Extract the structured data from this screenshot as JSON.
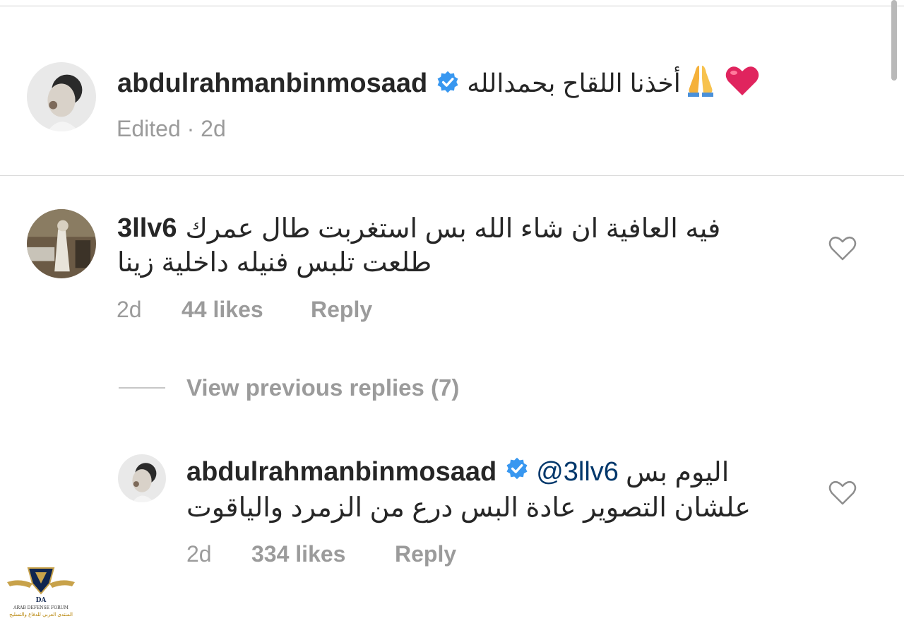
{
  "post": {
    "username": "abdulrahmanbinmosaad",
    "caption": "أخذنا اللقاح بحمدالله",
    "meta": "Edited · 2d"
  },
  "comment": {
    "username": "3llv6",
    "line1": "فيه العافية ان شاء الله بس استغربت طال عمرك",
    "line2": "طلعت تلبس فنيله داخلية زينا",
    "time": "2d",
    "likes": "44 likes",
    "reply": "Reply"
  },
  "replies": {
    "view_previous": "View previous replies (7)"
  },
  "reply": {
    "username": "abdulrahmanbinmosaad",
    "mention": "@3llv6",
    "line1_text": "اليوم بس",
    "line2": "علشان التصوير عادة البس درع من الزمرد والياقوت",
    "time": "2d",
    "likes": "334 likes",
    "reply": "Reply"
  },
  "watermark": {
    "mark": "DA",
    "title": "ARAB DEFENSE FORUM",
    "subtitle": "المنتدى العربي للدفاع والتسليح"
  },
  "icons": {
    "verified": "verified-badge-icon",
    "heart_outline": "heart-outline-icon",
    "colors": {
      "verified": "#3897f0",
      "heart": "#e0245e",
      "meta_gray": "#9b9b9b",
      "mention": "#00376b"
    }
  }
}
